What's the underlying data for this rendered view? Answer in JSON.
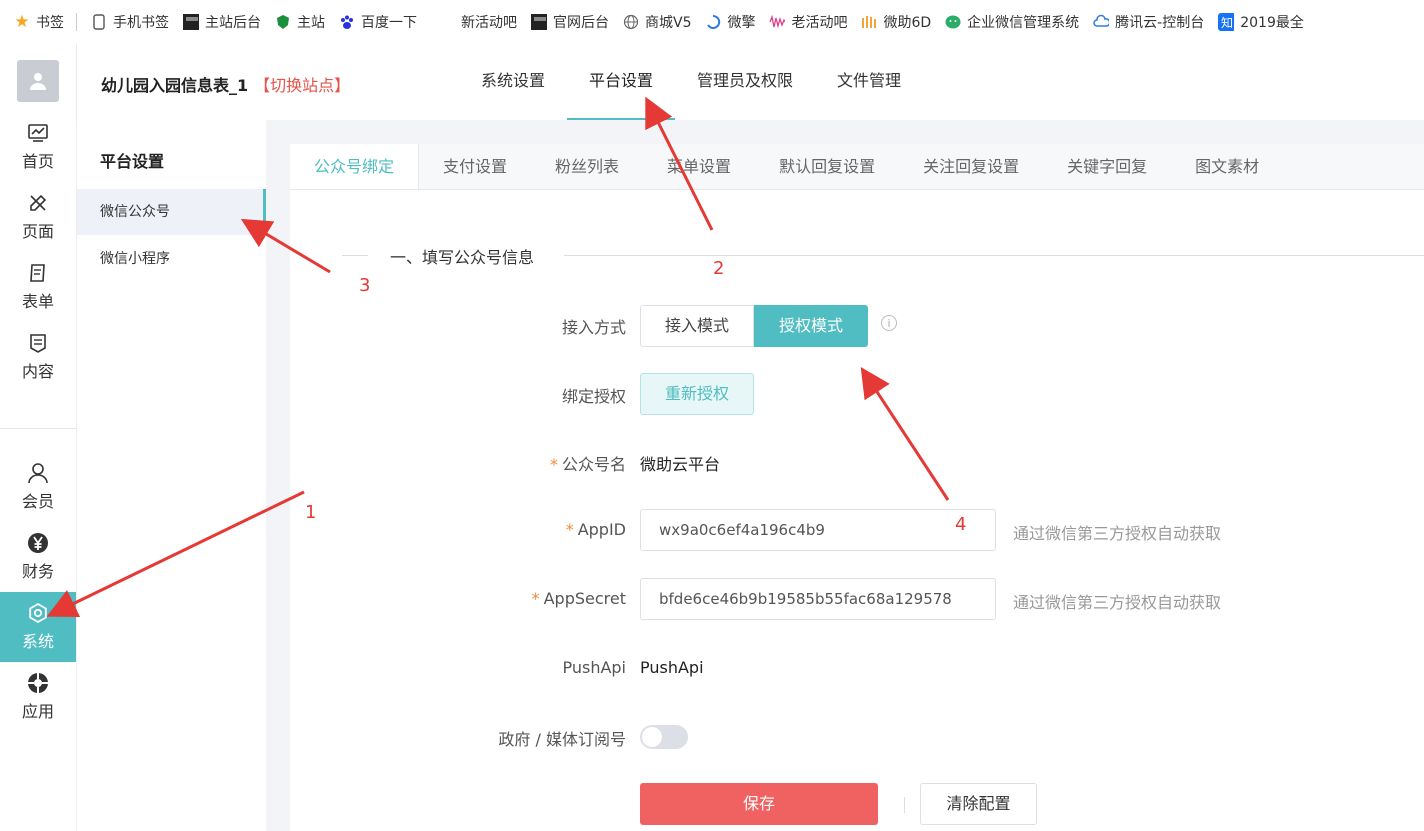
{
  "bookmarks": [
    {
      "label": "书签",
      "icon": "star-icon"
    },
    {
      "label": "手机书签",
      "icon": "phone-icon"
    },
    {
      "label": "主站后台",
      "icon": "site-logo-icon"
    },
    {
      "label": "主站",
      "icon": "shield-icon"
    },
    {
      "label": "百度一下",
      "icon": "baidu-paw-icon"
    },
    {
      "label": "新活动吧",
      "icon": "blank-icon"
    },
    {
      "label": "官网后台",
      "icon": "site-logo-icon"
    },
    {
      "label": "商城V5",
      "icon": "globe-icon"
    },
    {
      "label": "微擎",
      "icon": "swirl-icon"
    },
    {
      "label": "老活动吧",
      "icon": "wave-icon"
    },
    {
      "label": "微助6D",
      "icon": "bars-icon"
    },
    {
      "label": "企业微信管理系统",
      "icon": "wechat-icon"
    },
    {
      "label": "腾讯云-控制台",
      "icon": "cloud-icon"
    },
    {
      "label": "2019最全",
      "icon": "zhihu-icon"
    }
  ],
  "rail": [
    {
      "label": "首页",
      "icon": "dashboard-icon"
    },
    {
      "label": "页面",
      "icon": "design-icon"
    },
    {
      "label": "表单",
      "icon": "form-icon"
    },
    {
      "label": "内容",
      "icon": "document-icon"
    },
    {
      "label": "会员",
      "icon": "user-icon"
    },
    {
      "label": "财务",
      "icon": "yen-icon"
    },
    {
      "label": "系统",
      "icon": "gear-icon"
    },
    {
      "label": "应用",
      "icon": "apps-icon"
    }
  ],
  "header": {
    "site_title": "幼儿园入园信息表_1",
    "switch_site": "【切换站点】",
    "nav": [
      "系统设置",
      "平台设置",
      "管理员及权限",
      "文件管理"
    ]
  },
  "subnav": {
    "title": "平台设置",
    "items": [
      "微信公众号",
      "微信小程序"
    ]
  },
  "tabs": [
    "公众号绑定",
    "支付设置",
    "粉丝列表",
    "菜单设置",
    "默认回复设置",
    "关注回复设置",
    "关键字回复",
    "图文素材"
  ],
  "form": {
    "section_title": "一、填写公众号信息",
    "access_mode_label": "接入方式",
    "access_mode_options": [
      "接入模式",
      "授权模式"
    ],
    "bind_label": "绑定授权",
    "reauth_button": "重新授权",
    "account_name_label": "公众号名",
    "account_name_value": "微助云平台",
    "appid_label": "AppID",
    "appid_value": "wx9a0c6ef4a196c4b9",
    "appid_hint": "通过微信第三方授权自动获取",
    "appsecret_label": "AppSecret",
    "appsecret_value": "bfde6ce46b9b19585b55fac68a129578",
    "appsecret_hint": "通过微信第三方授权自动获取",
    "pushapi_label": "PushApi",
    "pushapi_value": "PushApi",
    "gov_label": "政府 / 媒体订阅号",
    "required_mark": "*",
    "info_glyph": "i",
    "save_button": "保存",
    "clear_button": "清除配置"
  },
  "annotations": [
    "1",
    "2",
    "3",
    "4"
  ],
  "colors": {
    "accent": "#4fbdc1",
    "danger": "#f06262",
    "annotation": "#e53935"
  }
}
